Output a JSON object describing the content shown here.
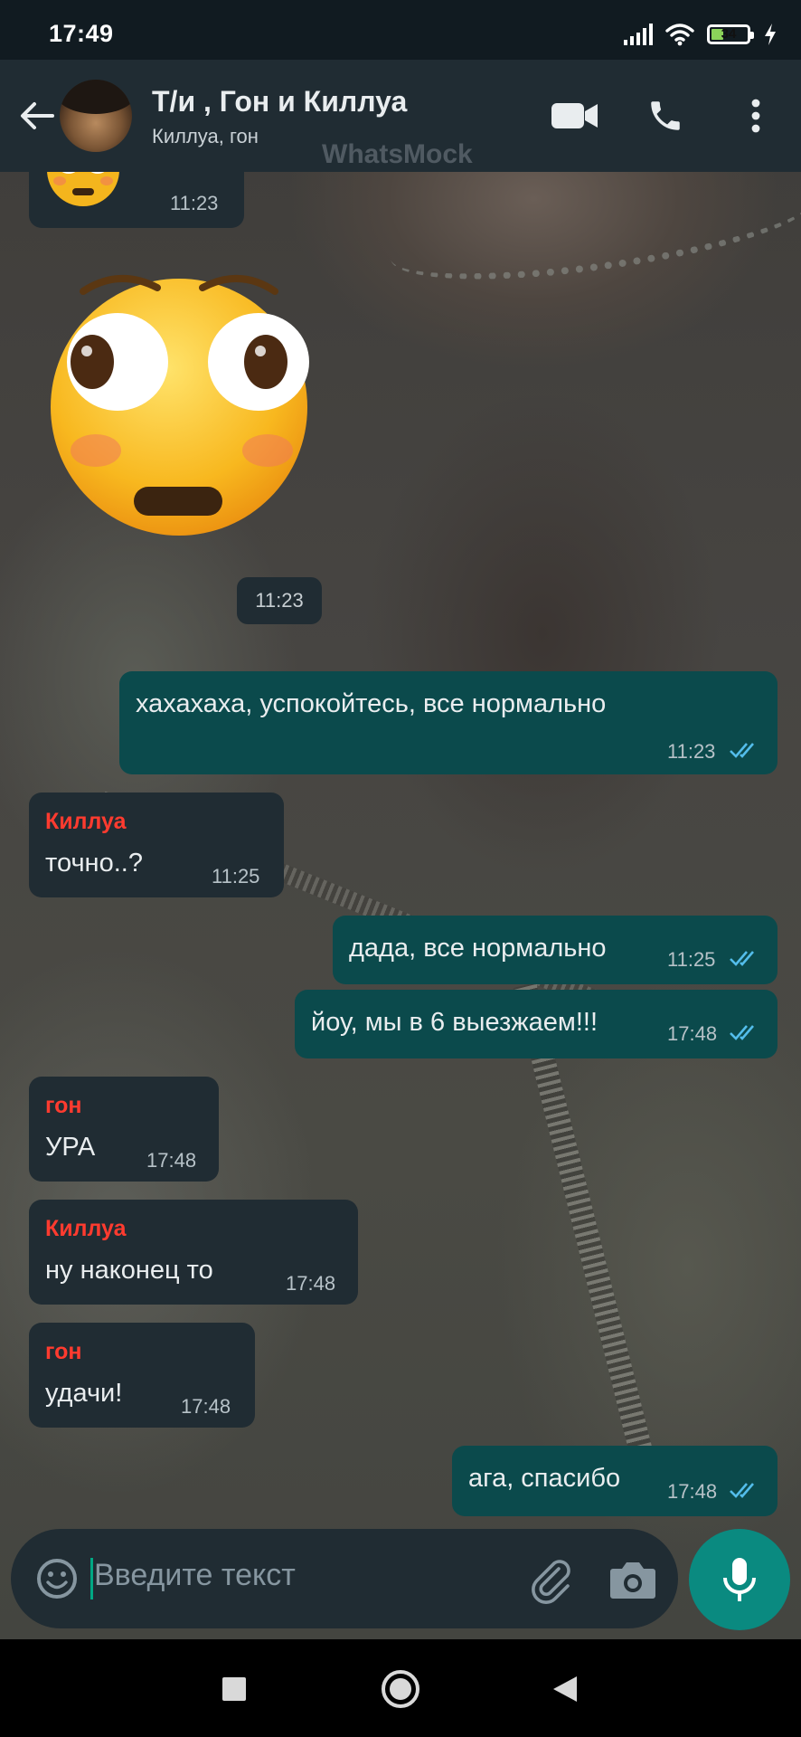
{
  "status_bar": {
    "time": "17:49",
    "battery_level": "34",
    "battery_fraction": 0.34,
    "icons": [
      "signal-icon",
      "wifi-icon",
      "battery-icon",
      "charging-icon"
    ]
  },
  "header": {
    "title": "Т/и , Гон и Киллуа",
    "subtitle": "Киллуа, гон",
    "watermark": "WhatsMock",
    "icons": [
      "back-arrow-icon",
      "video-call-icon",
      "voice-call-icon",
      "more-vert-icon"
    ]
  },
  "messages": [
    {
      "direction": "in",
      "type": "emoji",
      "time": "11:23"
    },
    {
      "direction": "in",
      "type": "big-emoji",
      "time": "11:23"
    },
    {
      "direction": "out",
      "text": "хахахаха, успокойтесь, все нормально",
      "time": "11:23",
      "status": "read"
    },
    {
      "direction": "in",
      "sender": "Киллуа",
      "text": "точно..?",
      "time": "11:25"
    },
    {
      "direction": "out",
      "text": "дада, все нормально",
      "time": "11:25",
      "status": "read"
    },
    {
      "direction": "out",
      "text": "йоу, мы в 6 выезжаем!!!",
      "time": "17:48",
      "status": "read"
    },
    {
      "direction": "in",
      "sender": "гон",
      "text": "УРА",
      "time": "17:48"
    },
    {
      "direction": "in",
      "sender": "Киллуа",
      "text": "ну наконец то",
      "time": "17:48"
    },
    {
      "direction": "in",
      "sender": "гон",
      "text": "удачи!",
      "time": "17:48"
    },
    {
      "direction": "out",
      "text": "ага, спасибо",
      "time": "17:48",
      "status": "read"
    }
  ],
  "colors": {
    "sender_name": "#ff3b2f",
    "tick_read": "#53bdeb",
    "accent": "#00a884"
  },
  "input": {
    "placeholder": "Введите текст"
  }
}
